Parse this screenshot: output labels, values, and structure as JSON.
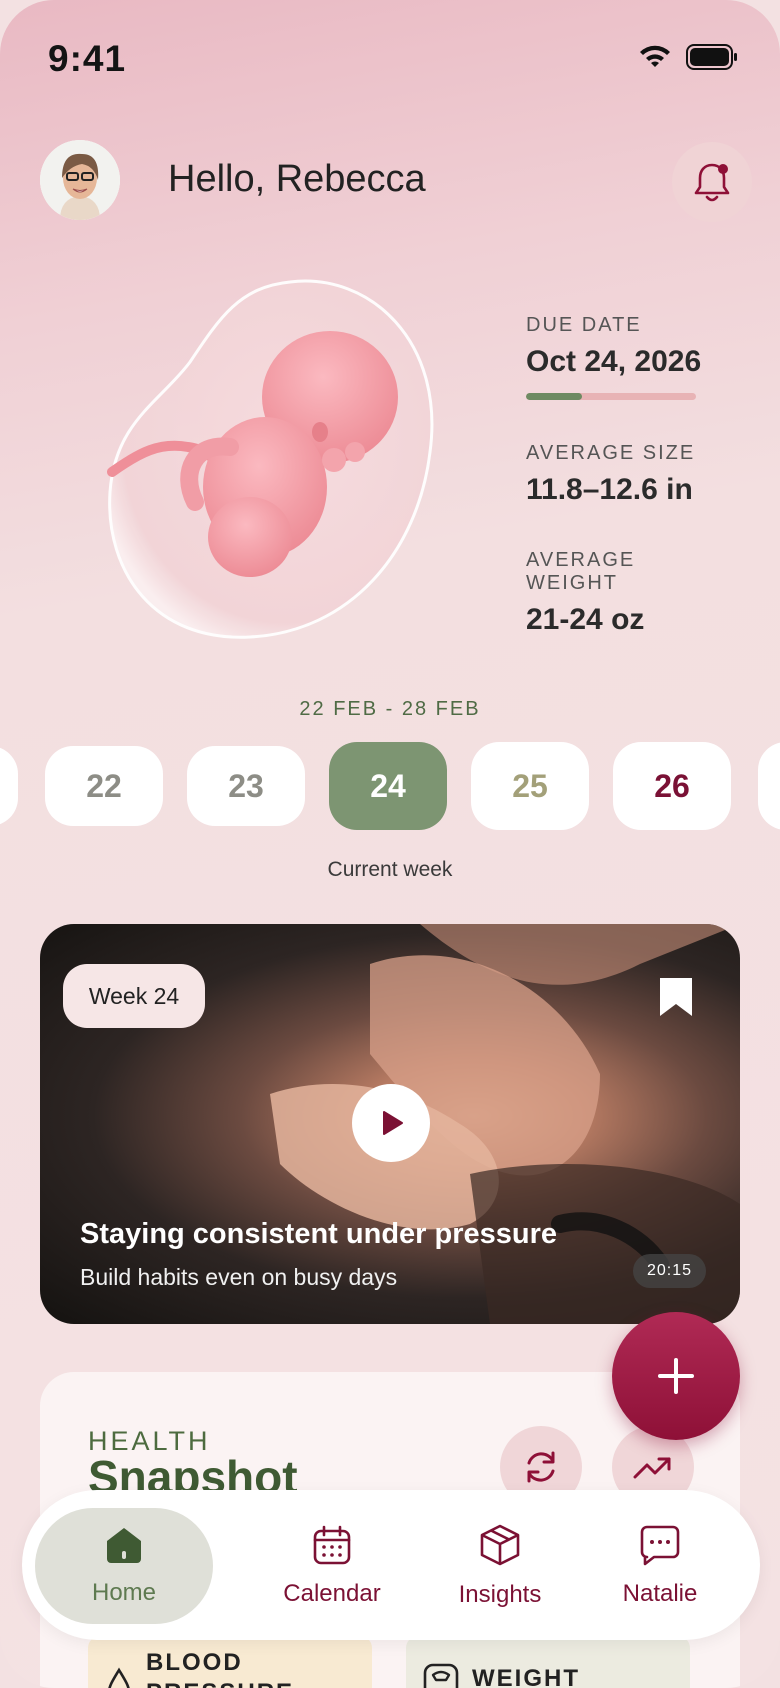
{
  "status": {
    "time": "9:41"
  },
  "header": {
    "greeting": "Hello, Rebecca"
  },
  "stats": [
    {
      "label": "DUE DATE",
      "value": "Oct 24, 2026",
      "progress": 0.33
    },
    {
      "label": "AVERAGE SIZE",
      "value": "11.8–12.6 in"
    },
    {
      "label": "AVERAGE WEIGHT",
      "value": "21-24 oz"
    }
  ],
  "week_selector": {
    "range": "22 FEB - 28 FEB",
    "days": [
      "22",
      "23",
      "24",
      "25",
      "26"
    ],
    "selected": "24",
    "caption": "Current week"
  },
  "video": {
    "week_tag": "Week 24",
    "title": "Staying consistent under pressure",
    "subtitle": "Build habits even on busy days",
    "duration": "20:15"
  },
  "health": {
    "caption": "HEALTH",
    "title": "Snapshot",
    "tiles": [
      {
        "label": "BLOOD PRESSURE",
        "icon": "drop-icon",
        "color": "#f8ead2"
      },
      {
        "label": "WEIGHT",
        "icon": "scale-icon",
        "color": "#ecebe0"
      }
    ]
  },
  "nav": [
    {
      "label": "Home",
      "icon": "home-icon",
      "active": true
    },
    {
      "label": "Calendar",
      "icon": "calendar-icon"
    },
    {
      "label": "Insights",
      "icon": "box-icon"
    },
    {
      "label": "Natalie",
      "icon": "chat-icon"
    }
  ],
  "colors": {
    "accent": "#8e1037",
    "green": "#7d9572",
    "background": "#f3e1e2"
  }
}
